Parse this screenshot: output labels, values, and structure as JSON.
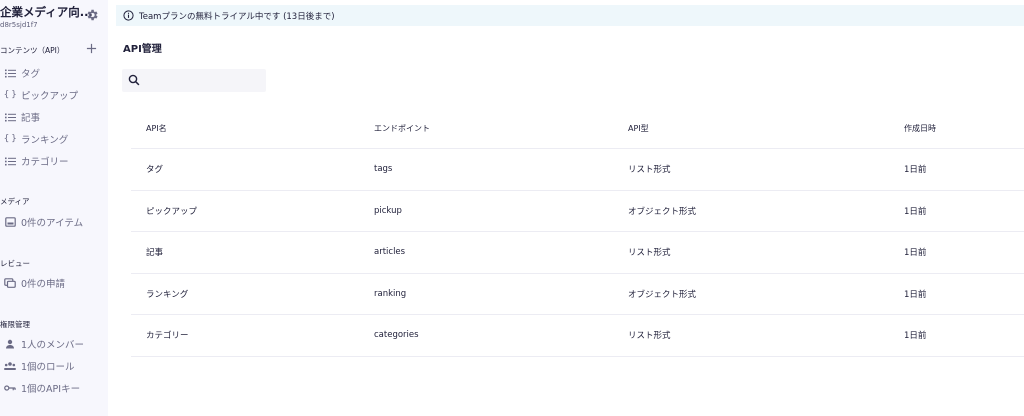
{
  "sidebar": {
    "service_name": "企業メディア向...",
    "service_id": "d8r5sjd1f7",
    "sections": {
      "contents": "コンテンツ（API）",
      "media": "メディア",
      "review": "レビュー",
      "permissions": "権限管理"
    },
    "api_items": [
      {
        "label": "タグ",
        "icon": "list-icon"
      },
      {
        "label": "ピックアップ",
        "icon": "braces-icon"
      },
      {
        "label": "記事",
        "icon": "list-icon"
      },
      {
        "label": "ランキング",
        "icon": "braces-icon"
      },
      {
        "label": "カテゴリー",
        "icon": "list-icon"
      }
    ],
    "media_item": "0件のアイテム",
    "review_item": "0件の申請",
    "permission_items": [
      {
        "label": "1人のメンバー",
        "icon": "person-icon"
      },
      {
        "label": "1個のロール",
        "icon": "group-icon"
      },
      {
        "label": "1個のAPIキー",
        "icon": "key-icon"
      }
    ]
  },
  "banner": {
    "text": "Teamプランの無料トライアル中です (13日後まで)"
  },
  "main": {
    "title": "API管理",
    "search": {
      "value": "",
      "placeholder": ""
    },
    "table": {
      "headers": [
        "API名",
        "エンドポイント",
        "API型",
        "作成日時"
      ],
      "rows": [
        [
          "タグ",
          "tags",
          "リスト形式",
          "1日前"
        ],
        [
          "ピックアップ",
          "pickup",
          "オブジェクト形式",
          "1日前"
        ],
        [
          "記事",
          "articles",
          "リスト形式",
          "1日前"
        ],
        [
          "ランキング",
          "ranking",
          "オブジェクト形式",
          "1日前"
        ],
        [
          "カテゴリー",
          "categories",
          "リスト形式",
          "1日前"
        ]
      ]
    }
  },
  "colors": {
    "accent": "#563bff",
    "sidebar_bg": "#f7f7fd",
    "banner_bg": "#eef7fb",
    "text": "#21213b",
    "muted": "#6b6b85"
  }
}
